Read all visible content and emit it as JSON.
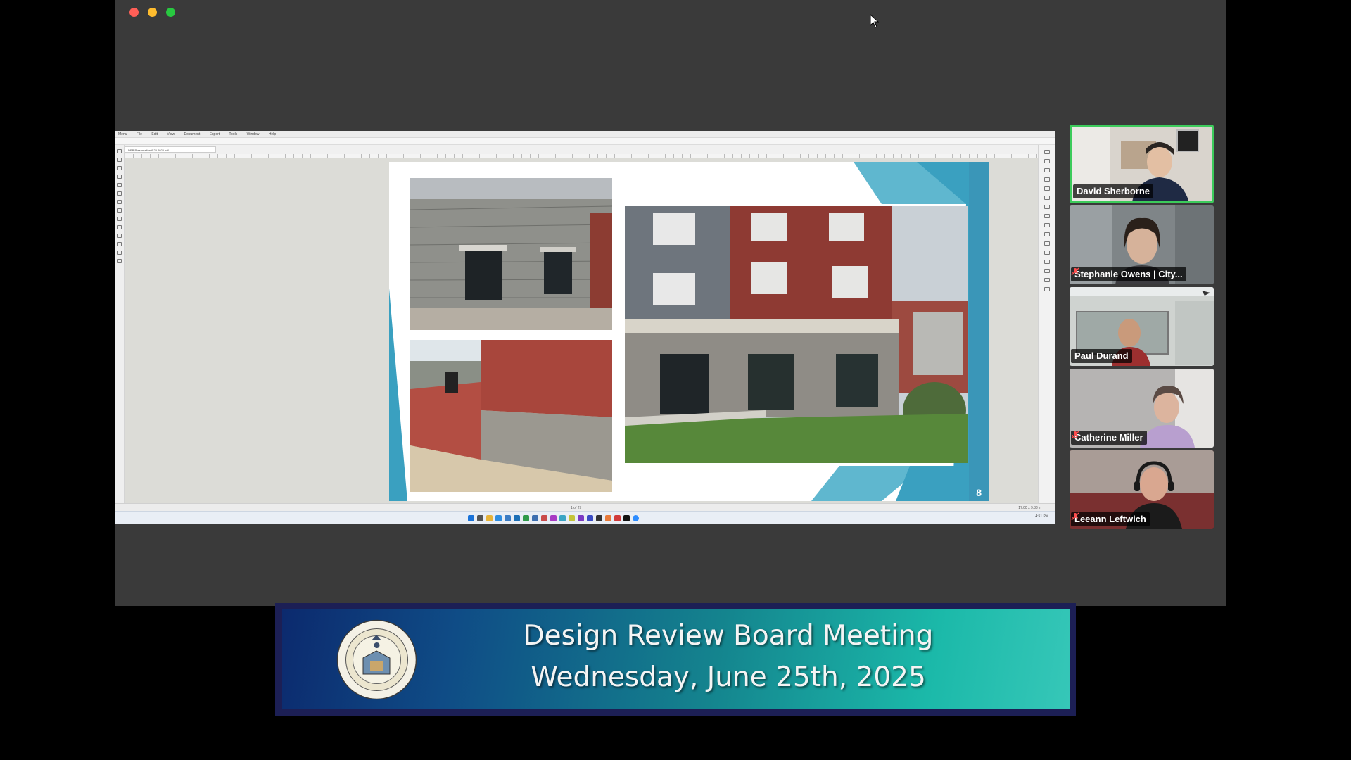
{
  "window": {
    "controls": {
      "close": "#ff5f57",
      "minimize": "#febc2e",
      "maximize": "#28c840"
    }
  },
  "shared_screen": {
    "menubar": [
      "Menu",
      "File",
      "Edit",
      "View",
      "Document",
      "Export",
      "Tools",
      "Window",
      "Help"
    ],
    "doc_tab": "DRB Presentation 6.25.2025.pdf",
    "slide_number": "8",
    "status_page": "1 of 27",
    "status_zoom": "17.00 x 9.38 in",
    "taskbar_clock": "4:51 PM"
  },
  "participants": [
    {
      "name": "David Sherborne",
      "active": true,
      "muted": false
    },
    {
      "name": "Stephanie Owens | City...",
      "active": false,
      "muted": true
    },
    {
      "name": "Paul Durand",
      "active": false,
      "muted": false
    },
    {
      "name": "Catherine Miller",
      "active": false,
      "muted": true
    },
    {
      "name": "Leeann Leftwich",
      "active": false,
      "muted": true
    }
  ],
  "banner": {
    "title": "Design Review Board Meeting",
    "date": "Wednesday, June 25th, 2025",
    "seal_text_top": "SALEM CONDITA A.D. 1626",
    "seal_text_bottom": "CIVITATIS REGIMINE DONATA"
  },
  "colors": {
    "active_speaker_border": "#3ccb5b",
    "banner_accent": "#1bb9a9",
    "slide_teal": "#3aa0c0"
  }
}
